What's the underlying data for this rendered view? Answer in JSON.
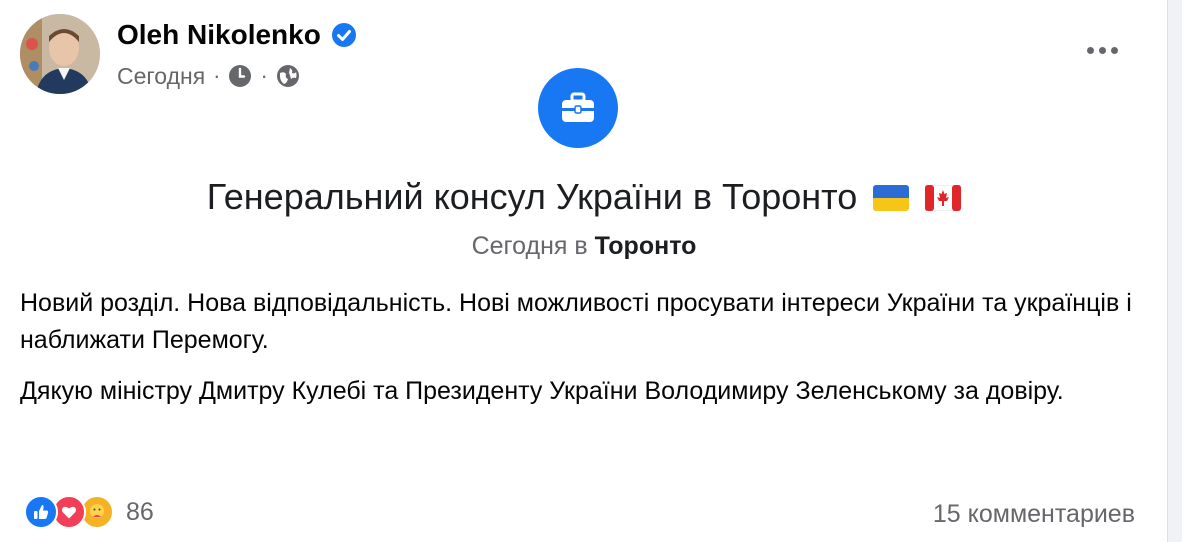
{
  "post": {
    "author": "Oleh Nikolenko",
    "timestamp": "Сегодня",
    "separator": "·",
    "event": {
      "icon": "briefcase-icon",
      "title": "Генеральний консул України в Торонто",
      "subtitle_prefix": "Сегодня в",
      "subtitle_place": "Торонто"
    },
    "paragraphs": [
      "Новий розділ. Нова відповідальність. Нові можливості просувати інтереси України та українців і наближати Перемогу.",
      "Дякую міністру Дмитру Кулебі та Президенту України Володимиру Зеленському за довіру."
    ],
    "reaction_count": "86",
    "comments": "15 комментариев"
  },
  "colors": {
    "accent": "#1877f2",
    "text": "#050505",
    "secondary": "#65676b",
    "love": "#f33e58",
    "care": "#f7b125"
  }
}
